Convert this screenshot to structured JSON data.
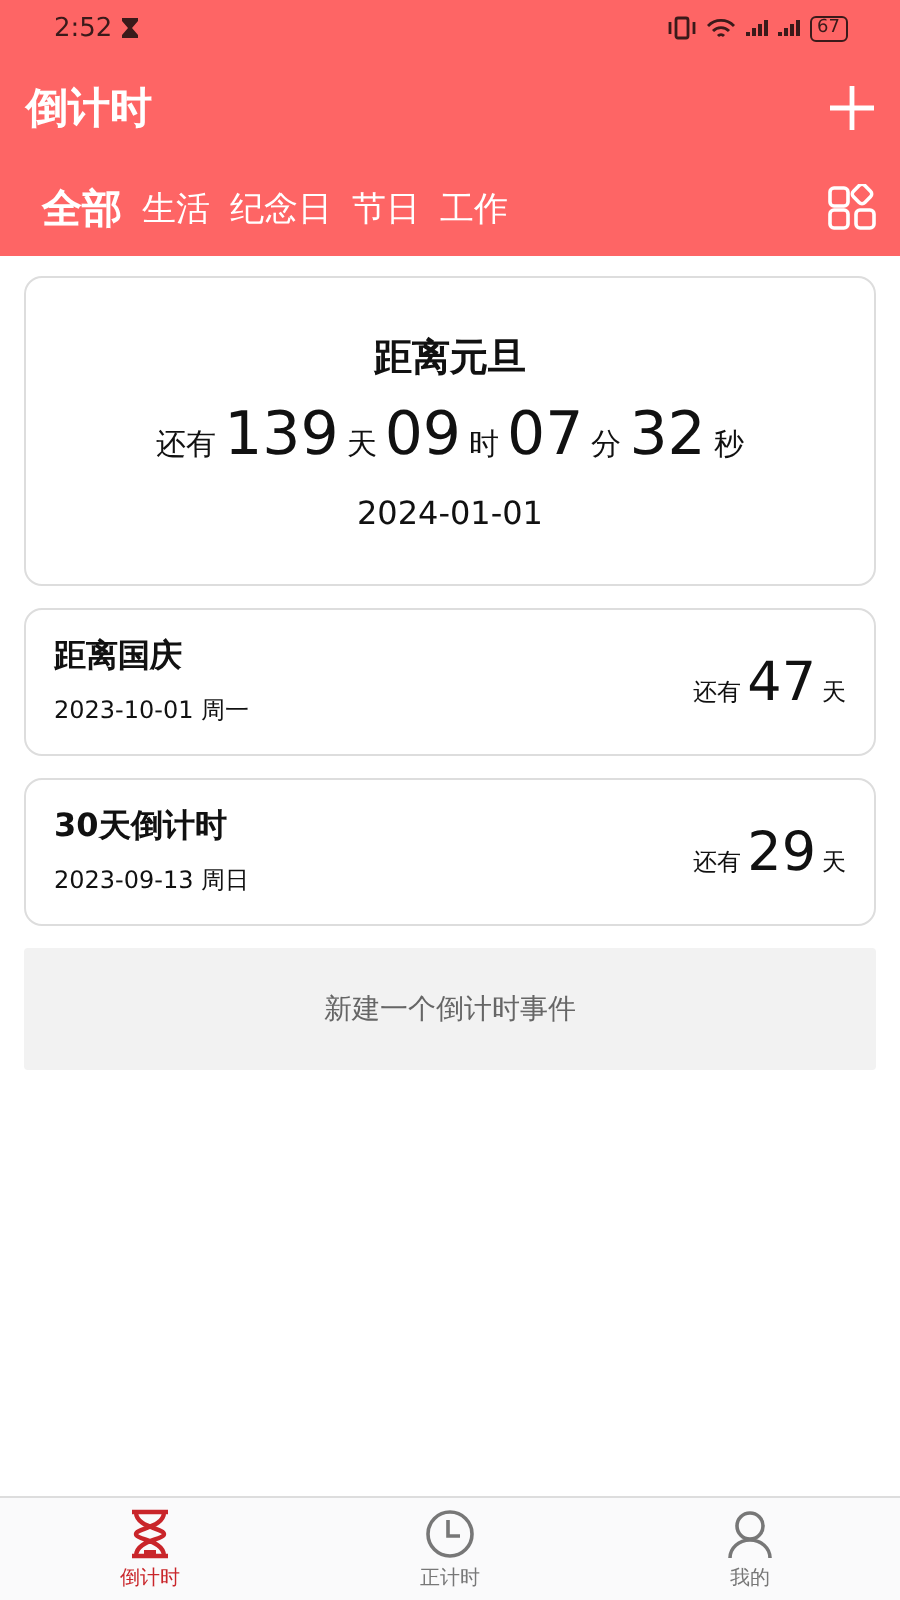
{
  "status_bar": {
    "time": "2:52",
    "battery": "67"
  },
  "header": {
    "title": "倒计时"
  },
  "tabs": [
    {
      "label": "全部",
      "selected": true
    },
    {
      "label": "生活",
      "selected": false
    },
    {
      "label": "纪念日",
      "selected": false
    },
    {
      "label": "节日",
      "selected": false
    },
    {
      "label": "工作",
      "selected": false
    }
  ],
  "featured": {
    "title": "距离元旦",
    "prefix": "还有",
    "parts": [
      {
        "value": "139",
        "unit": "天"
      },
      {
        "value": "09",
        "unit": "时"
      },
      {
        "value": "07",
        "unit": "分"
      },
      {
        "value": "32",
        "unit": "秒"
      }
    ],
    "date": "2024-01-01"
  },
  "events": [
    {
      "title": "距离国庆",
      "date": "2023-10-01 周一",
      "prefix": "还有",
      "value": "47",
      "unit": "天"
    },
    {
      "title": "30天倒计时",
      "date": "2023-09-13 周日",
      "prefix": "还有",
      "value": "29",
      "unit": "天"
    }
  ],
  "new_button": "新建一个倒计时事件",
  "nav": [
    {
      "label": "倒计时",
      "kind": "hourglass",
      "selected": true
    },
    {
      "label": "正计时",
      "kind": "clock",
      "selected": false
    },
    {
      "label": "我的",
      "kind": "person",
      "selected": false
    }
  ]
}
